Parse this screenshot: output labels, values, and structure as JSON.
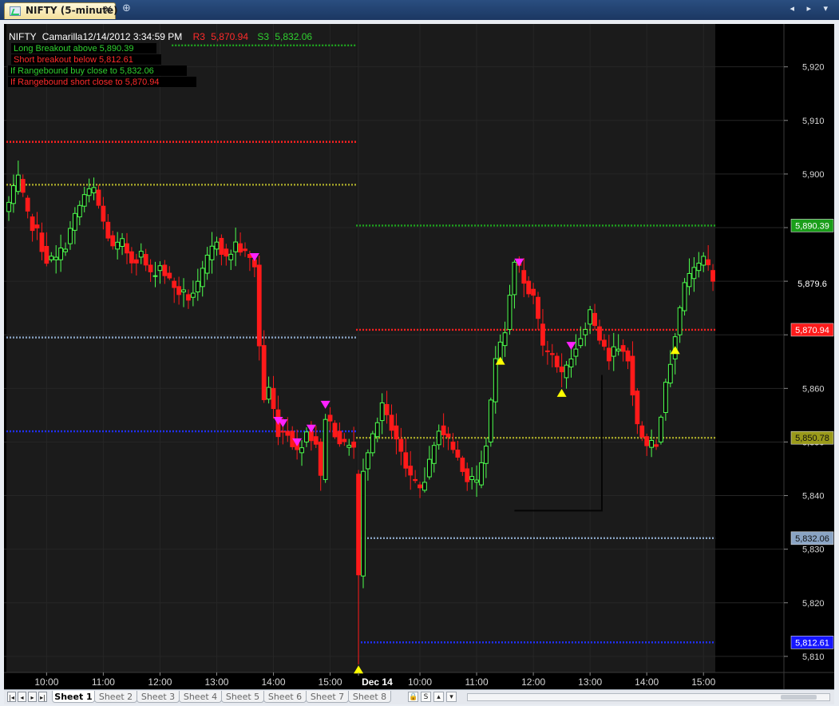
{
  "window": {
    "tab_label": "NIFTY (5-minute)",
    "close_glyph": "✕",
    "add_glyph": "⊕",
    "nav_glyphs": "◂ ▸ ▾"
  },
  "legend": {
    "header_symbol": "NIFTY",
    "header_indicator": "Camarilla",
    "header_datetime": "12/14/2012 3:34:59 PM",
    "r3_label": "R3",
    "r3_value": "5,870.94",
    "s3_label": "S3",
    "s3_value": "5,832.06",
    "lines": [
      {
        "text": "Long Breakout above  5,890.39",
        "color": "#2fd12f"
      },
      {
        "text": "Short breakout below  5,812.61",
        "color": "#ff2b2b"
      },
      {
        "text": "If Rangebound buy close to  5,832.06",
        "color": "#2fd12f"
      },
      {
        "text": "If Rangebound short close to  5,870.94",
        "color": "#ff2b2b"
      }
    ]
  },
  "colors": {
    "background": "#000000",
    "session_shade": "#1b1b1b",
    "grid": "#262626",
    "bull": "#4dff4d",
    "bear": "#ff1a1a",
    "buy_signal": "#ffff00",
    "sell_signal": "#ff22ff",
    "axis_text": "#d8d8d8"
  },
  "sheets": {
    "tabs": [
      "Sheet 1",
      "Sheet 2",
      "Sheet 3",
      "Sheet 4",
      "Sheet 5",
      "Sheet 6",
      "Sheet 7",
      "Sheet 8"
    ],
    "active": 0
  },
  "chart_data": {
    "type": "candlestick",
    "symbol": "NIFTY",
    "interval": "5-minute",
    "ylim": [
      5807,
      5928
    ],
    "y_ticks": [
      5810,
      5820,
      5830,
      5840,
      5850,
      5860,
      5870,
      5880,
      5890,
      5900,
      5910,
      5920
    ],
    "y_tick_labels": [
      "5,810",
      "5,820",
      "5,830",
      "5,840",
      "5,850",
      "5,860",
      "",
      "",
      "",
      "5,900",
      "5,910",
      "5,920"
    ],
    "x_tick_labels": [
      "10:00",
      "11:00",
      "12:00",
      "13:00",
      "14:00",
      "15:00",
      "Dec 14",
      "10:00",
      "11:00",
      "12:00",
      "13:00",
      "14:00",
      "15:00"
    ],
    "x_tick_bars": [
      8,
      20,
      32,
      44,
      56,
      68,
      74,
      87,
      99,
      111,
      123,
      135,
      147
    ],
    "grid": true,
    "sessions": [
      {
        "start_bar": 0,
        "end_bar": 73
      },
      {
        "start_bar": 74,
        "end_bar": 149
      }
    ],
    "price_tags": [
      {
        "value": 5890.39,
        "label": "5,890.39",
        "bg": "#1a9e1a",
        "fg": "#ffffff"
      },
      {
        "value": 5879.6,
        "label": "5,879.6",
        "bg": "#000000",
        "fg": "#ffffff"
      },
      {
        "value": 5870.94,
        "label": "5,870.94",
        "bg": "#ff1a1a",
        "fg": "#ffffff"
      },
      {
        "value": 5850.78,
        "label": "5,850.78",
        "bg": "#9a9a1a",
        "fg": "#111111"
      },
      {
        "value": 5832.06,
        "label": "5,832.06",
        "bg": "#8aa4c4",
        "fg": "#111111"
      },
      {
        "value": 5812.61,
        "label": "5,812.61",
        "bg": "#1515ff",
        "fg": "#ffffff"
      }
    ],
    "levels": [
      {
        "name": "Long Breakout",
        "value": 5924.0,
        "from_bar": 35,
        "to_bar": 73,
        "color": "#1fa81f"
      },
      {
        "name": "R3",
        "value": 5906.0,
        "from_bar": 0,
        "to_bar": 73,
        "color": "#ff2020"
      },
      {
        "name": "Pivot",
        "value": 5898.0,
        "from_bar": 0,
        "to_bar": 73,
        "color": "#a9a92a"
      },
      {
        "name": "S3",
        "value": 5869.5,
        "from_bar": 0,
        "to_bar": 73,
        "color": "#8aa4c4"
      },
      {
        "name": "Short Breakout",
        "value": 5852.0,
        "from_bar": 0,
        "to_bar": 73,
        "color": "#2030ff"
      },
      {
        "name": "Long Breakout",
        "value": 5890.39,
        "from_bar": 74,
        "to_bar": 149,
        "color": "#1fa81f"
      },
      {
        "name": "R3",
        "value": 5870.94,
        "from_bar": 74,
        "to_bar": 149,
        "color": "#ff2020"
      },
      {
        "name": "Pivot",
        "value": 5850.78,
        "from_bar": 74,
        "to_bar": 149,
        "color": "#a9a92a"
      },
      {
        "name": "S3",
        "value": 5832.06,
        "from_bar": 75,
        "to_bar": 149,
        "color": "#8aa4c4"
      },
      {
        "name": "Short Breakout",
        "value": 5812.61,
        "from_bar": 75,
        "to_bar": 149,
        "color": "#2030ff"
      }
    ],
    "anchors": [
      [
        0,
        5894.5
      ],
      [
        2,
        5899
      ],
      [
        4,
        5892
      ],
      [
        6,
        5889
      ],
      [
        8,
        5884
      ],
      [
        10,
        5884
      ],
      [
        12,
        5887
      ],
      [
        14,
        5892
      ],
      [
        16,
        5896
      ],
      [
        18,
        5897
      ],
      [
        20,
        5891
      ],
      [
        22,
        5886
      ],
      [
        24,
        5887
      ],
      [
        26,
        5884
      ],
      [
        28,
        5885
      ],
      [
        30,
        5881
      ],
      [
        32,
        5883
      ],
      [
        34,
        5880
      ],
      [
        36,
        5878
      ],
      [
        38,
        5877
      ],
      [
        40,
        5879
      ],
      [
        42,
        5884
      ],
      [
        44,
        5888
      ],
      [
        46,
        5884
      ],
      [
        48,
        5887
      ],
      [
        50,
        5885
      ],
      [
        52,
        5883
      ],
      [
        53,
        5868
      ],
      [
        54,
        5858
      ],
      [
        55,
        5860
      ],
      [
        57,
        5852
      ],
      [
        59,
        5852
      ],
      [
        61,
        5848
      ],
      [
        63,
        5852
      ],
      [
        65,
        5850
      ],
      [
        66,
        5843
      ],
      [
        67,
        5855
      ],
      [
        69,
        5852
      ],
      [
        71,
        5849
      ],
      [
        72,
        5850
      ],
      [
        73,
        5849
      ],
      [
        74,
        5825
      ],
      [
        75,
        5845
      ],
      [
        77,
        5851
      ],
      [
        79,
        5857
      ],
      [
        81,
        5853
      ],
      [
        83,
        5848
      ],
      [
        85,
        5843
      ],
      [
        87,
        5841
      ],
      [
        89,
        5846
      ],
      [
        91,
        5853
      ],
      [
        93,
        5850
      ],
      [
        95,
        5847
      ],
      [
        97,
        5843
      ],
      [
        99,
        5842
      ],
      [
        101,
        5850
      ],
      [
        103,
        5865
      ],
      [
        105,
        5871
      ],
      [
        107,
        5884
      ],
      [
        109,
        5880
      ],
      [
        111,
        5877
      ],
      [
        113,
        5867
      ],
      [
        115,
        5866
      ],
      [
        117,
        5862
      ],
      [
        119,
        5866
      ],
      [
        121,
        5870
      ],
      [
        123,
        5874
      ],
      [
        125,
        5869
      ],
      [
        127,
        5866
      ],
      [
        129,
        5868
      ],
      [
        131,
        5866
      ],
      [
        133,
        5853
      ],
      [
        135,
        5849
      ],
      [
        137,
        5850
      ],
      [
        139,
        5861
      ],
      [
        141,
        5870
      ],
      [
        143,
        5879
      ],
      [
        145,
        5882
      ],
      [
        147,
        5884
      ],
      [
        149,
        5880
      ]
    ],
    "last_bar": 149,
    "sell_signals": [
      52,
      57,
      58,
      61,
      64,
      67,
      108,
      119
    ],
    "buy_signals": [
      74,
      104,
      117,
      141
    ]
  }
}
